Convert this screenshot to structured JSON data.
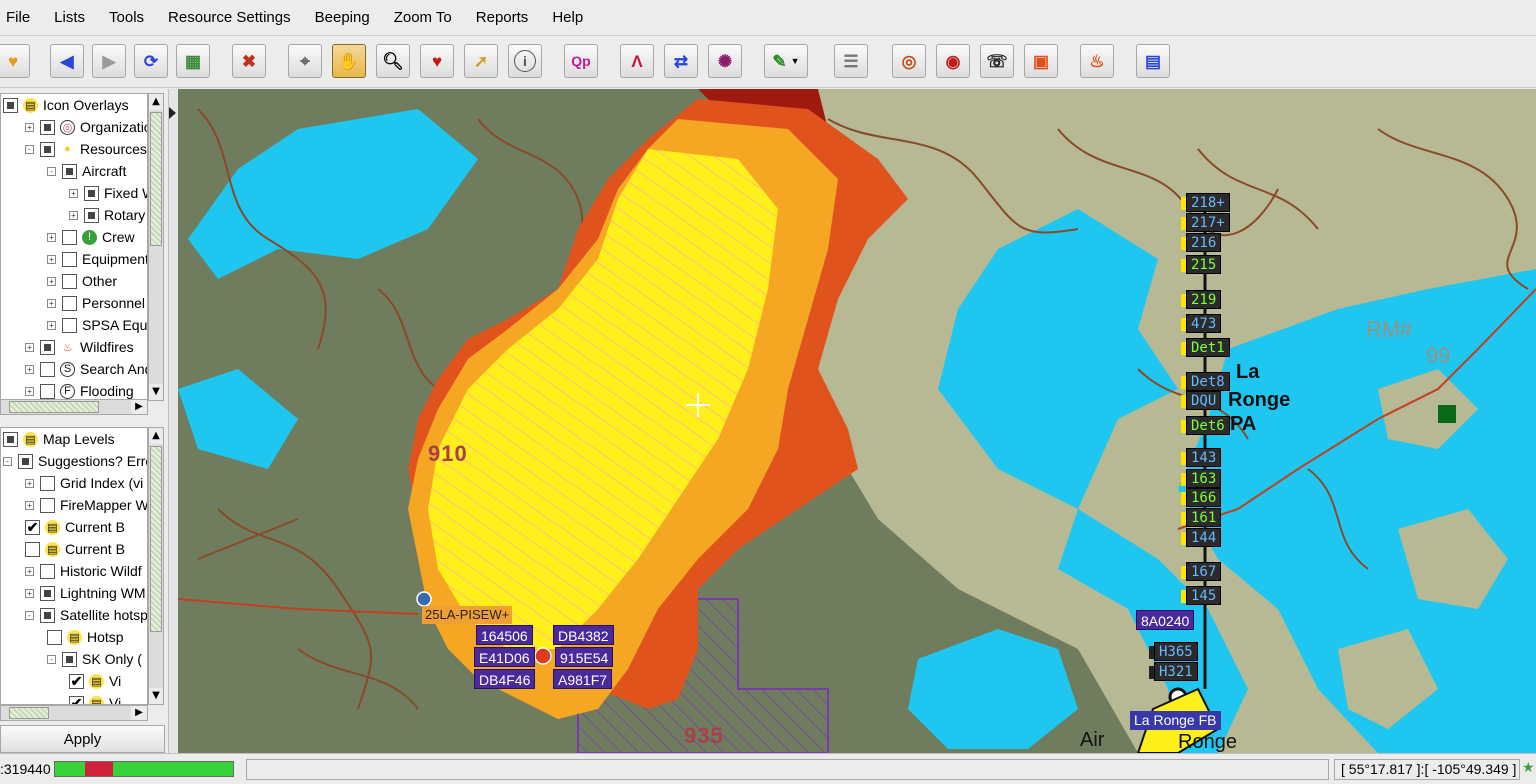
{
  "menu": [
    "File",
    "Lists",
    "Tools",
    "Resource Settings",
    "Beeping",
    "Zoom To",
    "Reports",
    "Help"
  ],
  "toolbar": {
    "icons": [
      "home-icon",
      "back-arrow-icon",
      "forward-arrow-icon",
      "refresh-icon",
      "layers-icon",
      "crosshair-tool-icon",
      "select-pointer-icon",
      "pan-hand-icon",
      "zoom-magnifier-icon",
      "marker-icon",
      "pointer-icon",
      "info-icon",
      "qp-icon",
      "measure-icon",
      "swap-icon",
      "target-icon",
      "draw-icon",
      "list-icon",
      "dispatch-icon",
      "radar-icon",
      "phone-icon",
      "report-icon",
      "fire-report-icon",
      "book-icon"
    ],
    "qp_label": "Qp",
    "info_label": "i"
  },
  "tree_top": [
    {
      "label": "Icon Overlays",
      "level": 0,
      "expander": "",
      "check": "partial",
      "icon": "layers-icon"
    },
    {
      "label": "Organization",
      "level": 1,
      "expander": "+",
      "check": "partial",
      "icon": "organization-icon"
    },
    {
      "label": "Resources",
      "level": 1,
      "expander": "-",
      "check": "partial",
      "icon": "resources-icon"
    },
    {
      "label": "Aircraft",
      "level": 2,
      "expander": "-",
      "check": "partial",
      "icon": ""
    },
    {
      "label": "Fixed Wir",
      "level": 3,
      "expander": "+",
      "check": "partial",
      "icon": ""
    },
    {
      "label": "Rotary W",
      "level": 3,
      "expander": "+",
      "check": "partial",
      "icon": ""
    },
    {
      "label": "Crew",
      "level": 2,
      "expander": "+",
      "check": "empty",
      "icon": "crew-icon"
    },
    {
      "label": "Equipment",
      "level": 2,
      "expander": "+",
      "check": "empty",
      "icon": ""
    },
    {
      "label": "Other",
      "level": 2,
      "expander": "+",
      "check": "empty",
      "icon": ""
    },
    {
      "label": "Personnel",
      "level": 2,
      "expander": "+",
      "check": "empty",
      "icon": ""
    },
    {
      "label": "SPSA Equipm",
      "level": 2,
      "expander": "+",
      "check": "empty",
      "icon": ""
    },
    {
      "label": "Wildfires",
      "level": 1,
      "expander": "+",
      "check": "partial",
      "icon": "wildfire-icon"
    },
    {
      "label": "Search And R",
      "level": 1,
      "expander": "+",
      "check": "empty",
      "icon": "search-rescue-icon"
    },
    {
      "label": "Flooding",
      "level": 1,
      "expander": "+",
      "check": "empty",
      "icon": "flooding-icon"
    }
  ],
  "tree_bottom": [
    {
      "label": "Map Levels",
      "level": 0,
      "expander": "",
      "check": "partial",
      "icon": "layers-icon"
    },
    {
      "label": "Suggestions? Erro",
      "level": 0,
      "expander": "-",
      "check": "partial",
      "icon": ""
    },
    {
      "label": "Grid Index (vi",
      "level": 1,
      "expander": "+",
      "check": "empty",
      "icon": ""
    },
    {
      "label": "FireMapper W",
      "level": 1,
      "expander": "+",
      "check": "empty",
      "icon": ""
    },
    {
      "label": "Current B",
      "level": 1,
      "expander": "",
      "check": "checked",
      "icon": "layers-icon"
    },
    {
      "label": "Current B",
      "level": 1,
      "expander": "",
      "check": "empty",
      "icon": "layers-icon"
    },
    {
      "label": "Historic Wildf",
      "level": 1,
      "expander": "+",
      "check": "empty",
      "icon": ""
    },
    {
      "label": "Lightning WM",
      "level": 1,
      "expander": "+",
      "check": "partial",
      "icon": ""
    },
    {
      "label": "Satellite hotsp",
      "level": 1,
      "expander": "-",
      "check": "partial",
      "icon": ""
    },
    {
      "label": "Hotsp",
      "level": 2,
      "expander": "",
      "check": "empty",
      "icon": "layers-icon"
    },
    {
      "label": "SK Only (",
      "level": 2,
      "expander": "-",
      "check": "partial",
      "icon": ""
    },
    {
      "label": "Vi",
      "level": 3,
      "expander": "",
      "check": "checked",
      "icon": "layers-icon"
    },
    {
      "label": "Vi",
      "level": 3,
      "expander": "",
      "check": "checked",
      "icon": "layers-icon"
    }
  ],
  "apply_label": "Apply",
  "map": {
    "fire_numbers": [
      {
        "text": "910",
        "key": "fire-910"
      },
      {
        "text": "935",
        "key": "fire-935"
      }
    ],
    "town_lines": [
      "La",
      "Ronge",
      "PA"
    ],
    "airport_label": "La Ronge FB",
    "air_text": "Air",
    "ronge_text": "Ronge",
    "faint_labels": [
      "RM#",
      "99"
    ],
    "fire_id_tag": "25LA-PISEW+",
    "aircraft_tags": [
      "164506",
      "DB4382",
      "E41D06",
      "915E54",
      "DB4F46",
      "A981F7"
    ],
    "side_tag": "8A0240",
    "heli_tags": [
      "H365",
      "H321"
    ],
    "resource_tags": [
      {
        "text": "218+",
        "style": "blue"
      },
      {
        "text": "217+",
        "style": "blue"
      },
      {
        "text": "216",
        "style": "blue"
      },
      {
        "text": "215",
        "style": "green"
      },
      {
        "text": "219",
        "style": "green"
      },
      {
        "text": "473",
        "style": "blue"
      },
      {
        "text": "Det1",
        "style": "green"
      },
      {
        "text": "Det8",
        "style": "blue"
      },
      {
        "text": "DQU",
        "style": "blue"
      },
      {
        "text": "Det6",
        "style": "green"
      },
      {
        "text": "143",
        "style": "blue"
      },
      {
        "text": "163",
        "style": "green"
      },
      {
        "text": "166",
        "style": "green"
      },
      {
        "text": "161",
        "style": "green"
      },
      {
        "text": "144",
        "style": "blue"
      },
      {
        "text": "167",
        "style": "blue"
      },
      {
        "text": "145",
        "style": "blue"
      }
    ],
    "colors": {
      "water": "#1fc7f0",
      "land_dark": "#6f7d5e",
      "land_light": "#b7b894",
      "contour": "#8a4a2a",
      "fire_yellow": "#ffef1a",
      "fire_orange": "#f5a623",
      "fire_red": "#e0531c",
      "fire_darkred": "#9e1a0e"
    }
  },
  "status": {
    "count": ":319440",
    "coords": "[ 55°17.817 ]:[ -105°49.349 ]",
    "progress_colors": [
      "#38d23a",
      "#d0203a"
    ]
  }
}
